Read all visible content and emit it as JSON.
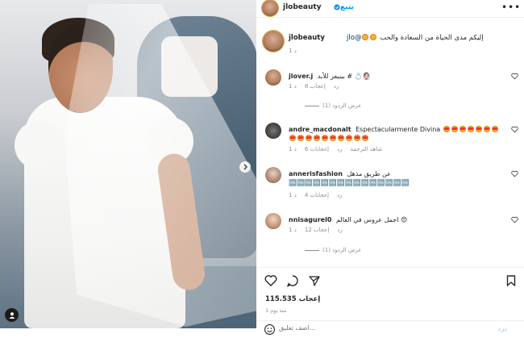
{
  "post": {
    "author": "jlobeauty",
    "follow_label": "يتبع",
    "more_label": "•••",
    "caption_text": "إليكم مدى الحياة من السعادة والحب ",
    "caption_mention": "@jlo",
    "caption_time": "1 د"
  },
  "comments": [
    {
      "username": "jlover.j",
      "text": "بينيفر للأبد # 💍👰🏻",
      "time": "1 د",
      "likes": "إعجاب 8",
      "reply": "رد",
      "translate": "",
      "view_replies": "عرض الردود (1)"
    },
    {
      "username": "andre_macdonalt",
      "text": "Espectacularmente Divina",
      "time": "1 د",
      "likes": "إعجابات 6",
      "reply": "رد",
      "translate": "شاهد الترجمة",
      "view_replies": ""
    },
    {
      "username": "annerisfashion",
      "text": "عن طريق مذهل 🆒🆒🆒🆒🆒🆒🆒🆒🆒🆒🆒🆒🆒🆒🆒",
      "time": "1 د",
      "likes": "إعجابات 4",
      "reply": "رد",
      "translate": "",
      "view_replies": ""
    },
    {
      "username": "nnisagurel0",
      "text": "اجمل عروس في العالم 😍",
      "time": "1 د",
      "likes": "إعجاب 12",
      "reply": "رد",
      "translate": "",
      "view_replies": "عرض الردود (1)"
    }
  ],
  "stats": {
    "likes": "115.535 إعجاب",
    "since": "منذ يوم 1"
  },
  "composer": {
    "placeholder": "اضف تعليق...",
    "post_label": "يرد"
  },
  "icons": {
    "like": "heart-icon",
    "comment": "comment-bubble-icon",
    "share": "paper-plane-icon",
    "save": "bookmark-icon",
    "emoji": "smiley-icon",
    "more": "ellipsis-icon",
    "verified": "verified-badge-icon"
  },
  "colors": {
    "accent": "#0095f6",
    "muted": "#8e8e8e",
    "post_disabled": "#b2dffc"
  }
}
